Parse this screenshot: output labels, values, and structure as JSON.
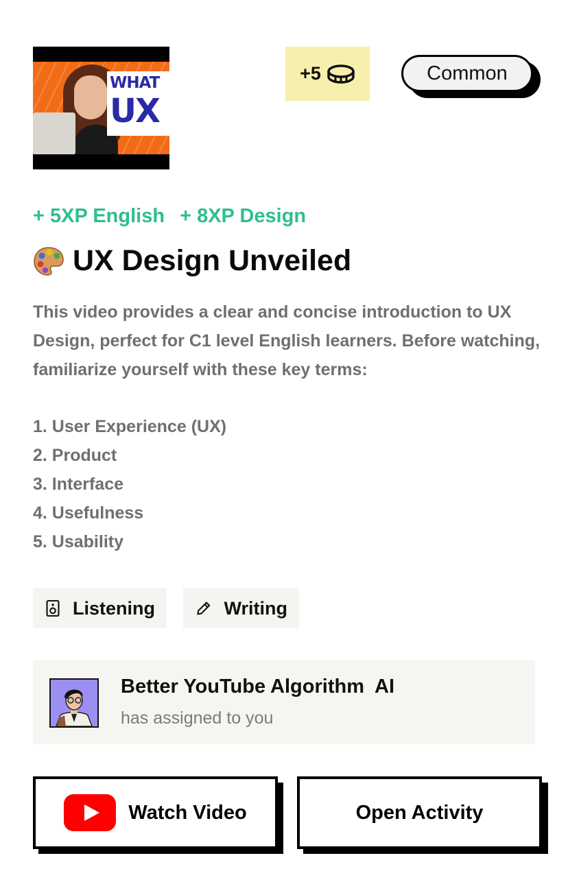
{
  "card": {
    "thumbnail": {
      "text_line1": "WHAT",
      "text_line2": "UX"
    },
    "reward": {
      "coins": "+5",
      "icon": "coin-icon"
    },
    "rarity": "Common",
    "xp": [
      "+ 5XP English",
      "+ 8XP Design"
    ],
    "title_emoji": "palette-icon",
    "title": "UX Design Unveiled",
    "description": "This video provides a clear and concise introduction to UX Design, perfect for C1 level English learners. Before watching, familiarize yourself with these key terms:",
    "terms": [
      "1. User Experience (UX)",
      "2. Product",
      "3. Interface",
      "4. Usefulness",
      "5. Usability"
    ],
    "skills": [
      {
        "label": "Listening",
        "icon": "speaker-icon"
      },
      {
        "label": "Writing",
        "icon": "pencil-icon"
      }
    ],
    "assigner": {
      "name": "Better YouTube Algorithm  AI",
      "subtitle": "has assigned to you"
    },
    "buttons": {
      "watch": "Watch Video",
      "open": "Open Activity"
    }
  },
  "colors": {
    "xp_green": "#2ebf8c",
    "coin_badge_bg": "#f7f0ad",
    "youtube_red": "#ff0000",
    "chip_bg": "#f5f4f1"
  }
}
